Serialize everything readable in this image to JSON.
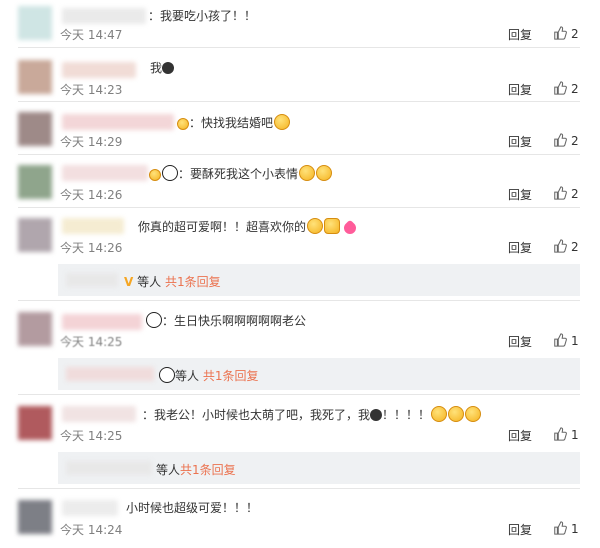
{
  "comments": [
    {
      "text": "：我要吃小孩了！！",
      "time": "今天 14:47",
      "reply": "回复",
      "likes": "2"
    },
    {
      "text": "我",
      "time": "今天 14:23",
      "reply": "回复",
      "likes": "2"
    },
    {
      "text": "：快找我结婚吧",
      "time": "今天 14:29",
      "reply": "回复",
      "likes": "2"
    },
    {
      "text": "：要酥死我这个小表情",
      "time": "今天 14:26",
      "reply": "回复",
      "likes": "2"
    },
    {
      "text": "你真的超可爱啊！！超喜欢你的",
      "time": "今天 14:26",
      "reply": "回复",
      "likes": "2",
      "sub": {
        "who": "等人",
        "count": "共1条回复"
      }
    },
    {
      "text": "：生日快乐啊啊啊啊啊老公",
      "time": "今天 14:25",
      "reply": "回复",
      "likes": "1",
      "sub": {
        "who": "等人",
        "count": "共1条回复"
      }
    },
    {
      "text": "：我老公！小时候也太萌了吧，我死了，我",
      "text2": "！！！！",
      "time": "今天 14:25",
      "reply": "回复",
      "likes": "1",
      "sub": {
        "who": "等人",
        "count": "共1条回复"
      }
    },
    {
      "text": "小时候也超级可爱！！！",
      "time": "今天 14:24",
      "reply": "回复",
      "likes": "1"
    }
  ],
  "colors": {
    "time": "#808080",
    "reply_count": "#eb7350",
    "sub_bg": "#eff1f3"
  },
  "icons": {
    "like": "thumbs-up-icon"
  }
}
